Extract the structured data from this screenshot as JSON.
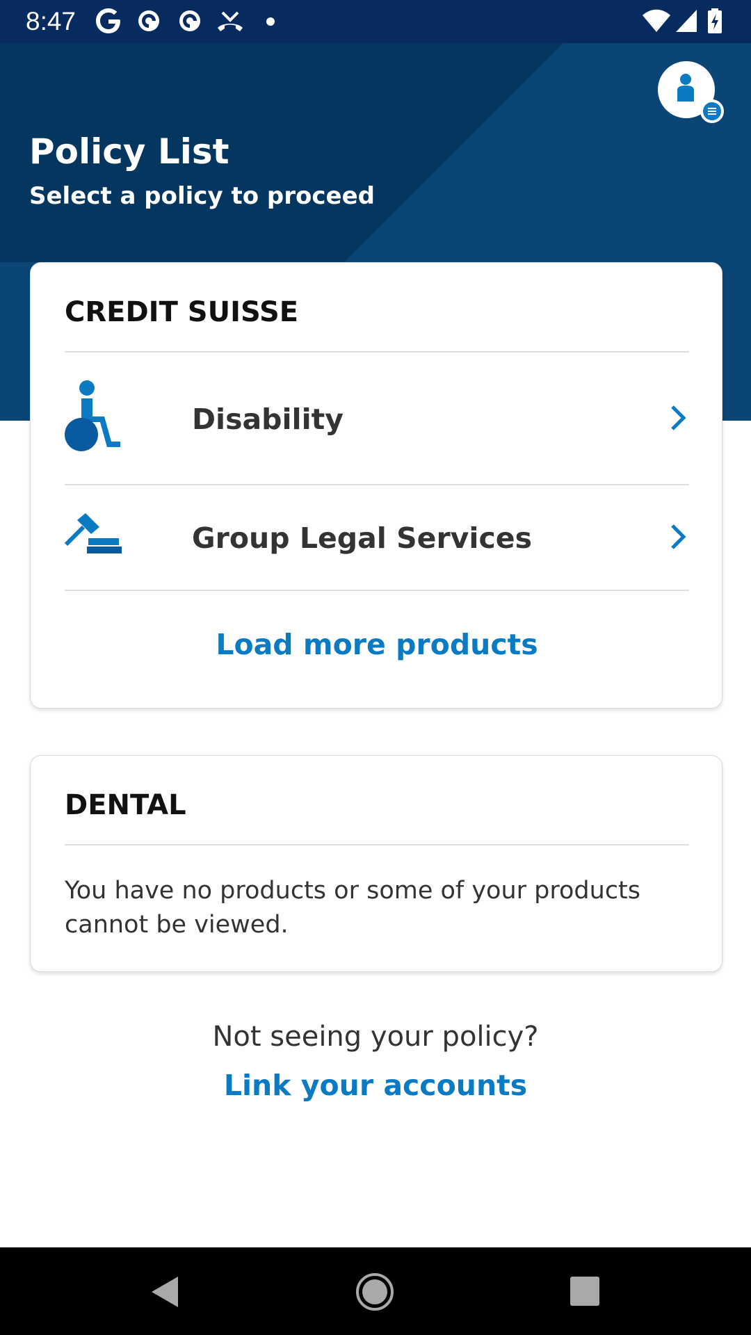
{
  "status_bar": {
    "time": "8:47",
    "left_icons": [
      "google-icon",
      "pocket-casts-icon",
      "pocket-casts-icon",
      "missed-call-icon",
      "notification-dot-icon"
    ],
    "right_icons": [
      "wifi-icon",
      "signal-icon",
      "battery-icon"
    ]
  },
  "header": {
    "title": "Policy List",
    "subtitle": "Select a policy to proceed",
    "profile_icon": "person-icon",
    "background_color": "#0a4576",
    "accent_color": "#0a7ac3"
  },
  "cards": [
    {
      "heading": "CREDIT SUISSE",
      "items": [
        {
          "label": "Disability",
          "icon": "wheelchair-icon"
        },
        {
          "label": "Group Legal Services",
          "icon": "gavel-icon"
        }
      ],
      "load_more_label": "Load more products"
    },
    {
      "heading": "DENTAL",
      "message": "You have no products or some of your products cannot be viewed."
    }
  ],
  "footer": {
    "prompt": "Not seeing your policy?",
    "link_label": "Link your accounts"
  },
  "nav_bar": {
    "buttons": [
      "back-icon",
      "home-icon",
      "recents-icon"
    ]
  }
}
